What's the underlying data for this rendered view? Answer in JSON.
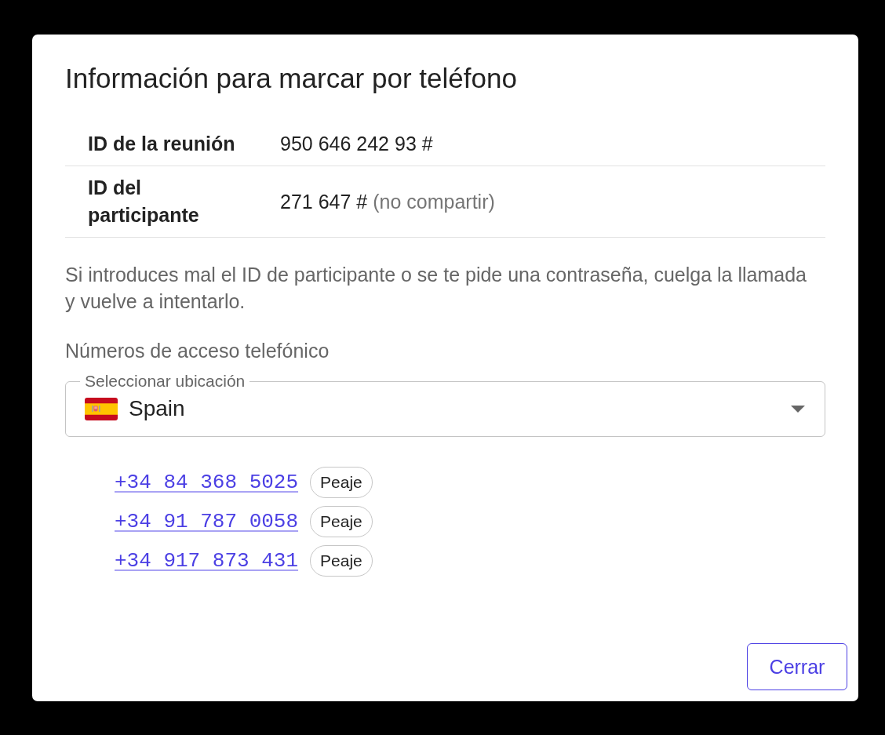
{
  "dialog": {
    "title": "Información para marcar por teléfono",
    "details": [
      {
        "label": "ID de la reunión",
        "value": "950 646 242 93 #"
      },
      {
        "label": "ID del participante",
        "value": "271 647 #",
        "note": "(no compartir)"
      }
    ],
    "hint": "Si introduces mal el ID de participante o se te pide una contraseña, cuelga la llamada y vuelve a intentarlo.",
    "access_heading": "Números de acceso telefónico",
    "location_select": {
      "label": "Seleccionar ubicación",
      "value": "Spain"
    },
    "numbers": [
      {
        "number": "+34 84 368 5025",
        "tag": "Peaje"
      },
      {
        "number": "+34 91 787 0058",
        "tag": "Peaje"
      },
      {
        "number": "+34 917 873 431",
        "tag": "Peaje"
      }
    ],
    "buttons": [
      {
        "label": "Cerrar"
      }
    ]
  }
}
